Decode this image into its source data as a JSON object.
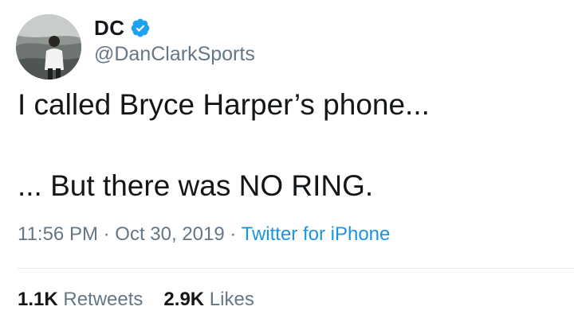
{
  "user": {
    "display_name": "DC",
    "handle": "@DanClarkSports",
    "verified": true
  },
  "tweet": {
    "line1": "I called Bryce Harper’s phone...",
    "line2": "... But there was NO RING."
  },
  "meta": {
    "time": "11:56 PM",
    "sep1": " · ",
    "date": "Oct 30, 2019",
    "sep2": " · ",
    "source": "Twitter for iPhone"
  },
  "stats": {
    "retweets_count": "1.1K",
    "retweets_label": "Retweets",
    "likes_count": "2.9K",
    "likes_label": "Likes"
  },
  "colors": {
    "verified": "#1da1f2",
    "link": "#1b95e0",
    "secondary_text": "#657786"
  }
}
